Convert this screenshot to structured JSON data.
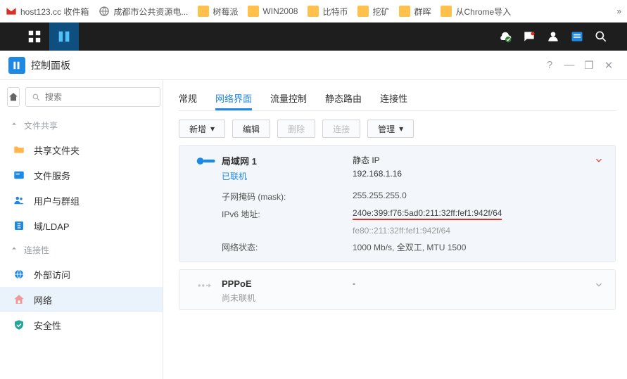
{
  "bookmarks": [
    {
      "label": "host123.cc 收件箱",
      "icon": "mail"
    },
    {
      "label": "成都市公共资源电...",
      "icon": "globe"
    },
    {
      "label": "树莓派",
      "icon": "folder"
    },
    {
      "label": "WIN2008",
      "icon": "folder"
    },
    {
      "label": "比特币",
      "icon": "folder"
    },
    {
      "label": "挖矿",
      "icon": "folder"
    },
    {
      "label": "群晖",
      "icon": "folder"
    },
    {
      "label": "从Chrome导入",
      "icon": "folder"
    }
  ],
  "bm_more": "»",
  "window": {
    "title": "控制面板"
  },
  "search_placeholder": "搜索",
  "sections": {
    "share": "文件共享",
    "conn": "连接性"
  },
  "sidebar_items": [
    {
      "label": "共享文件夹",
      "icon": "folder",
      "color": "#ffb74d"
    },
    {
      "label": "文件服务",
      "icon": "drive",
      "color": "#1e88e5"
    },
    {
      "label": "用户与群组",
      "icon": "users",
      "color": "#1e88e5"
    },
    {
      "label": "域/LDAP",
      "icon": "ldap",
      "color": "#1e88e5"
    }
  ],
  "sidebar_conn": [
    {
      "label": "外部访问",
      "icon": "globe",
      "color": "#1e88e5"
    },
    {
      "label": "网络",
      "icon": "network",
      "active": true,
      "color": "#e57373"
    },
    {
      "label": "安全性",
      "icon": "shield",
      "color": "#26a69a"
    }
  ],
  "tabs": {
    "t0": "常规",
    "t1": "网络界面",
    "t2": "流量控制",
    "t3": "静态路由",
    "t4": "连接性"
  },
  "toolbar": {
    "add": "新增",
    "edit": "编辑",
    "delete": "删除",
    "conn": "连接",
    "manage": "管理"
  },
  "lan": {
    "title": "局域网 1",
    "status": "已联机",
    "mode": "静态 IP",
    "ip": "192.168.1.16",
    "mask_k": "子网掩码 (mask):",
    "mask_v": "255.255.255.0",
    "ipv6_k": "IPv6 地址:",
    "ipv6_1": "240e:399:f76:5ad0:211:32ff:fef1:942f/64",
    "ipv6_2": "fe80::211:32ff:fef1:942f/64",
    "state_k": "网络状态:",
    "state_v": "1000 Mb/s, 全双工, MTU 1500"
  },
  "pppoe": {
    "title": "PPPoE",
    "status": "尚未联机",
    "mode": "-"
  }
}
